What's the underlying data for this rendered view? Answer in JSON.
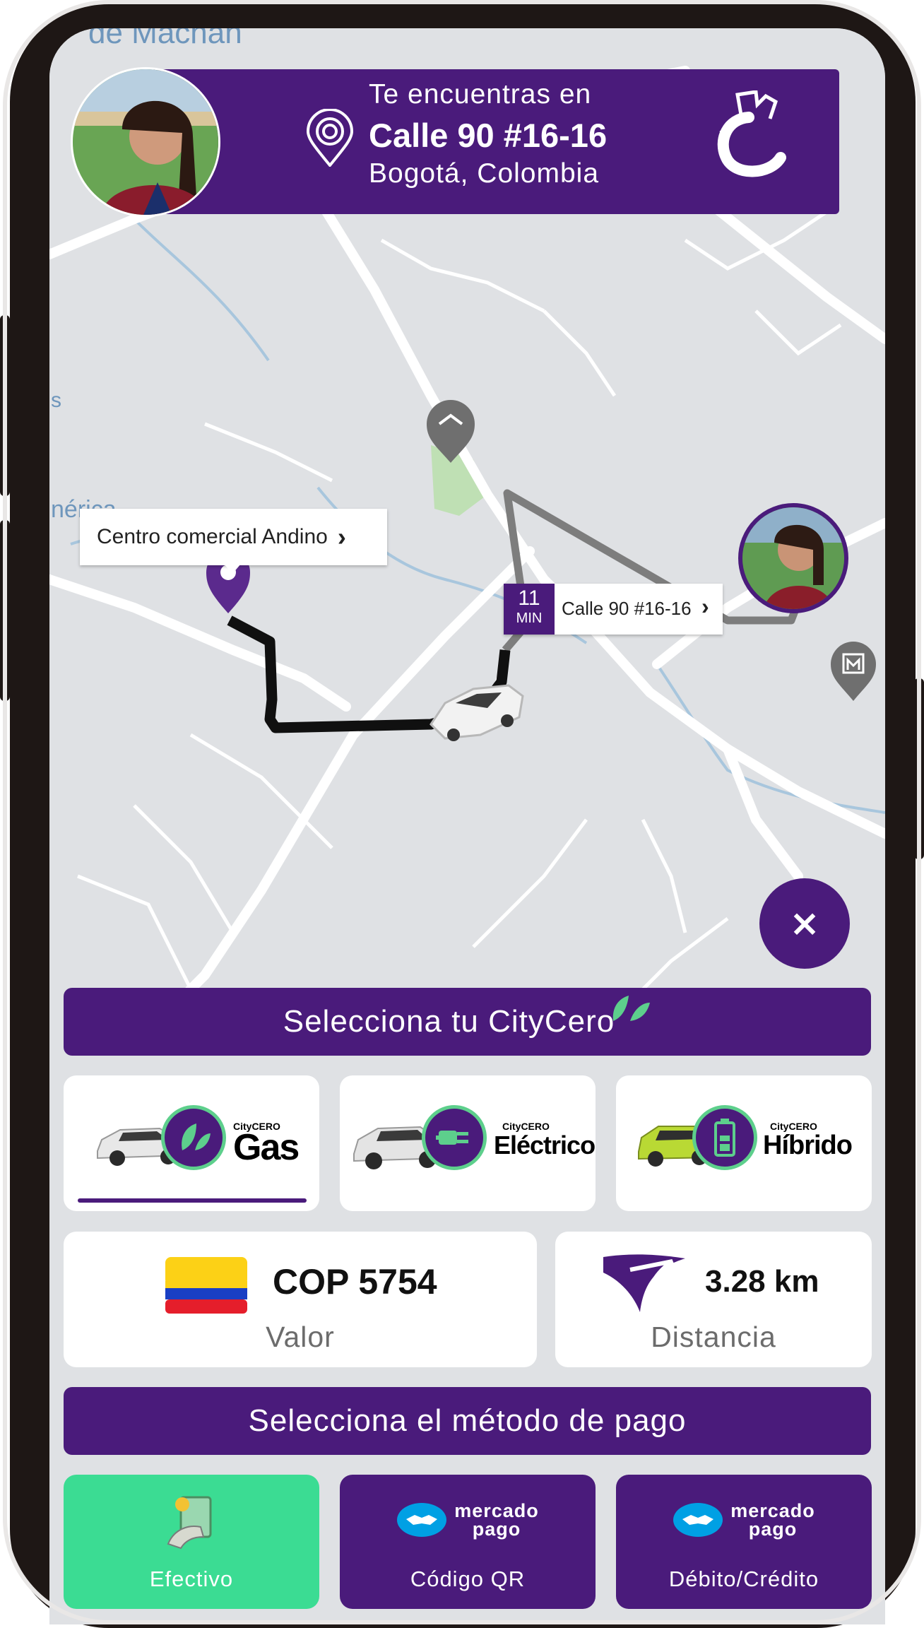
{
  "header": {
    "line1": "Te encuentras en",
    "address": "Calle 90 #16-16",
    "city": "Bogotá, Colombia"
  },
  "map": {
    "top_label": "de Machan",
    "left_label_1": "s",
    "left_label_2": "nérica",
    "origin_callout": "Centro comercial Andino",
    "eta_minutes": "11",
    "eta_unit": "MIN",
    "dest_callout": "Calle 90 #16-16",
    "chevron": "›"
  },
  "close_label": "×",
  "select_car": {
    "title": "Selecciona tu CityCero"
  },
  "car_options": [
    {
      "brand": "CityCERO",
      "name": "Gas",
      "selected": true
    },
    {
      "brand": "CityCERO",
      "name": "Eléctrico",
      "selected": false
    },
    {
      "brand": "CityCERO",
      "name": "Híbrido",
      "selected": false
    }
  ],
  "price": {
    "value": "COP 5754",
    "label": "Valor"
  },
  "distance": {
    "value": "3.28 km",
    "label": "Distancia"
  },
  "payment": {
    "title": "Selecciona el método de pago",
    "options": [
      {
        "label": "Efectivo"
      },
      {
        "label": "Código QR",
        "logo_line1": "mercado",
        "logo_line2": "pago"
      },
      {
        "label": "Débito/Crédito",
        "logo_line1": "mercado",
        "logo_line2": "pago"
      }
    ]
  },
  "colors": {
    "brand_purple": "#4a1b7b",
    "accent_green": "#5dcf8c",
    "cash_green": "#3bdc93",
    "map_bg": "#dfe1e4"
  }
}
